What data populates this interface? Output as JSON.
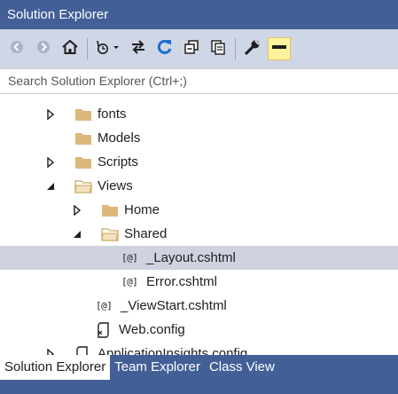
{
  "window": {
    "title": "Solution Explorer"
  },
  "toolbar": {
    "buttons": [
      {
        "icon": "back-icon"
      },
      {
        "icon": "forward-icon"
      },
      {
        "icon": "home-icon"
      },
      {
        "icon": "pending-changes-filter-icon"
      },
      {
        "icon": "sync-with-active-document-icon"
      },
      {
        "icon": "refresh-icon"
      },
      {
        "icon": "collapse-all-icon"
      },
      {
        "icon": "show-all-files-icon"
      },
      {
        "icon": "properties-wrench-icon"
      },
      {
        "icon": "preview-selected-items-icon"
      }
    ]
  },
  "search": {
    "placeholder": "Search Solution Explorer (Ctrl+;)"
  },
  "tree": {
    "items": [
      {
        "label": "fonts",
        "expander": "collapsed",
        "icon": "folder-icon"
      },
      {
        "label": "Models",
        "expander": "none",
        "icon": "folder-icon"
      },
      {
        "label": "Scripts",
        "expander": "collapsed",
        "icon": "folder-icon"
      },
      {
        "label": "Views",
        "expander": "expanded",
        "icon": "folder-open-icon"
      },
      {
        "label": "Home",
        "expander": "collapsed",
        "icon": "folder-icon"
      },
      {
        "label": "Shared",
        "expander": "expanded",
        "icon": "folder-open-icon"
      },
      {
        "label": "_Layout.cshtml",
        "expander": "none",
        "icon": "razor-file-icon",
        "selected": true
      },
      {
        "label": "Error.cshtml",
        "expander": "none",
        "icon": "razor-file-icon"
      },
      {
        "label": "_ViewStart.cshtml",
        "expander": "none",
        "icon": "razor-file-icon"
      },
      {
        "label": "Web.config",
        "expander": "none",
        "icon": "config-file-icon"
      },
      {
        "label": "ApplicationInsights.config",
        "expander": "collapsed",
        "icon": "config-file-icon"
      }
    ],
    "razor_glyph": "[@]"
  },
  "bottom_tabs": [
    {
      "label": "Solution Explorer",
      "active": true
    },
    {
      "label": "Team Explorer",
      "active": false
    },
    {
      "label": "Class View",
      "active": false
    }
  ],
  "colors": {
    "title_bar": "#425f97",
    "toolbar": "#cfd6e5",
    "folder": "#dcb67a",
    "selected_row": "#cfd3e0",
    "active_toggle": "#fff29d"
  }
}
